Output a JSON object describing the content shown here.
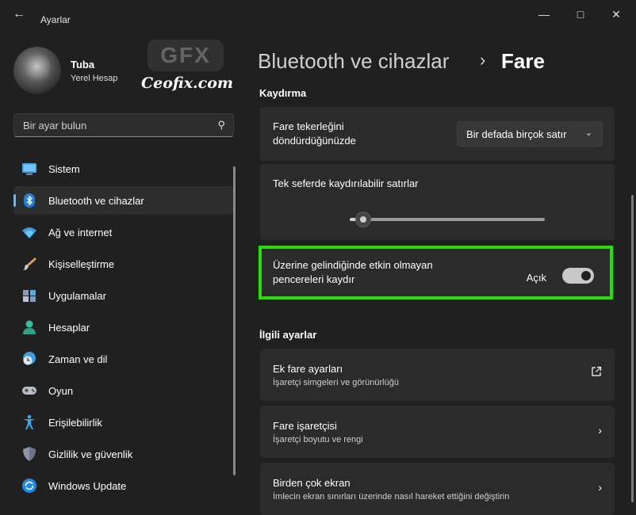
{
  "window": {
    "title": "Ayarlar",
    "back_icon": "back-arrow-icon",
    "controls": {
      "minimize": "—",
      "maximize": "□",
      "close": "✕"
    }
  },
  "user": {
    "name": "Tuba",
    "account_type": "Yerel Hesap"
  },
  "watermark": {
    "logo": "GFX",
    "text": "Ceofix.com"
  },
  "search": {
    "placeholder": "Bir ayar bulun"
  },
  "nav": {
    "items": [
      {
        "label": "Sistem",
        "icon": "monitor-icon",
        "active": false
      },
      {
        "label": "Bluetooth ve cihazlar",
        "icon": "bluetooth-icon",
        "active": true
      },
      {
        "label": "Ağ ve internet",
        "icon": "wifi-icon",
        "active": false
      },
      {
        "label": "Kişiselleştirme",
        "icon": "brush-icon",
        "active": false
      },
      {
        "label": "Uygulamalar",
        "icon": "apps-icon",
        "active": false
      },
      {
        "label": "Hesaplar",
        "icon": "person-icon",
        "active": false
      },
      {
        "label": "Zaman ve dil",
        "icon": "globe-clock-icon",
        "active": false
      },
      {
        "label": "Oyun",
        "icon": "gamepad-icon",
        "active": false
      },
      {
        "label": "Erişilebilirlik",
        "icon": "accessibility-icon",
        "active": false
      },
      {
        "label": "Gizlilik ve güvenlik",
        "icon": "shield-icon",
        "active": false
      },
      {
        "label": "Windows Update",
        "icon": "update-icon",
        "active": false
      }
    ]
  },
  "breadcrumb": {
    "parent": "Bluetooth ve cihazlar",
    "separator": "›",
    "current": "Fare"
  },
  "scrolling": {
    "section_title": "Kaydırma",
    "wheel": {
      "label_line1": "Fare tekerleğini",
      "label_line2": "döndürdüğünüzde",
      "value": "Bir defada birçok satır"
    },
    "lines": {
      "label": "Tek seferde kaydırılabilir satırlar",
      "slider_fraction": 0.07
    },
    "inactive": {
      "label_line1": "Üzerine gelindiğinde etkin olmayan",
      "label_line2": "pencereleri kaydır",
      "state": "Açık",
      "on": true
    }
  },
  "related": {
    "section_title": "İlgili ayarlar",
    "cards": [
      {
        "title": "Ek fare ayarları",
        "subtitle": "İşaretçi simgeleri ve görünürlüğü",
        "action_icon": "external-link-icon"
      },
      {
        "title": "Fare işaretçisi",
        "subtitle": "İşaretçi boyutu ve rengi",
        "action_icon": "chevron-right-icon"
      },
      {
        "title": "Birden çok ekran",
        "subtitle": "İmlecin ekran sınırları üzerinde nasıl hareket ettiğini değiştirin",
        "action_icon": "chevron-right-icon"
      }
    ]
  },
  "colors": {
    "accent": "#4cc2ff",
    "highlight_box": "#26e000",
    "background": "#202020",
    "card": "#2b2b2b"
  }
}
